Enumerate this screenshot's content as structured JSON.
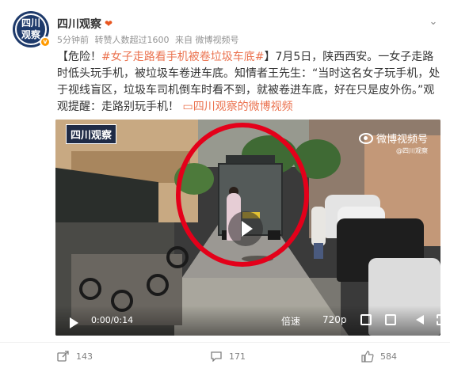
{
  "account": {
    "name": "四川观察",
    "avatar_line1": "四川",
    "avatar_line2": "观察",
    "vip_badge": "❤"
  },
  "meta": {
    "time": "5分钟前",
    "likes": "转赞人数超过1600",
    "source": "来自 微博视频号"
  },
  "post": {
    "prefix": "【危险！",
    "hashtag": "#女子走路看手机被卷垃圾车底#",
    "body": "】7月5日，陕西西安。一女子走路时低头玩手机，被垃圾车卷进车底。知情者王先生：“当时这名女子玩手机，处于视线盲区，垃圾车司机倒车时看不到，就被卷进车底，好在只是皮外伤。”观观提醒：走路别玩手机！",
    "video_link": "四川观察的微博视频"
  },
  "video": {
    "watermark_left": "四川观察",
    "watermark_right": "微博视频号",
    "watermark_handle": "@四川观察",
    "time": "0:00/0:14",
    "speed": "倍速",
    "quality": "720p"
  },
  "actions": {
    "share_count": "143",
    "comment_count": "171",
    "like_count": "584"
  },
  "colors": {
    "link": "#eb7350",
    "highlight": "#e4001a",
    "muted": "#939393"
  }
}
